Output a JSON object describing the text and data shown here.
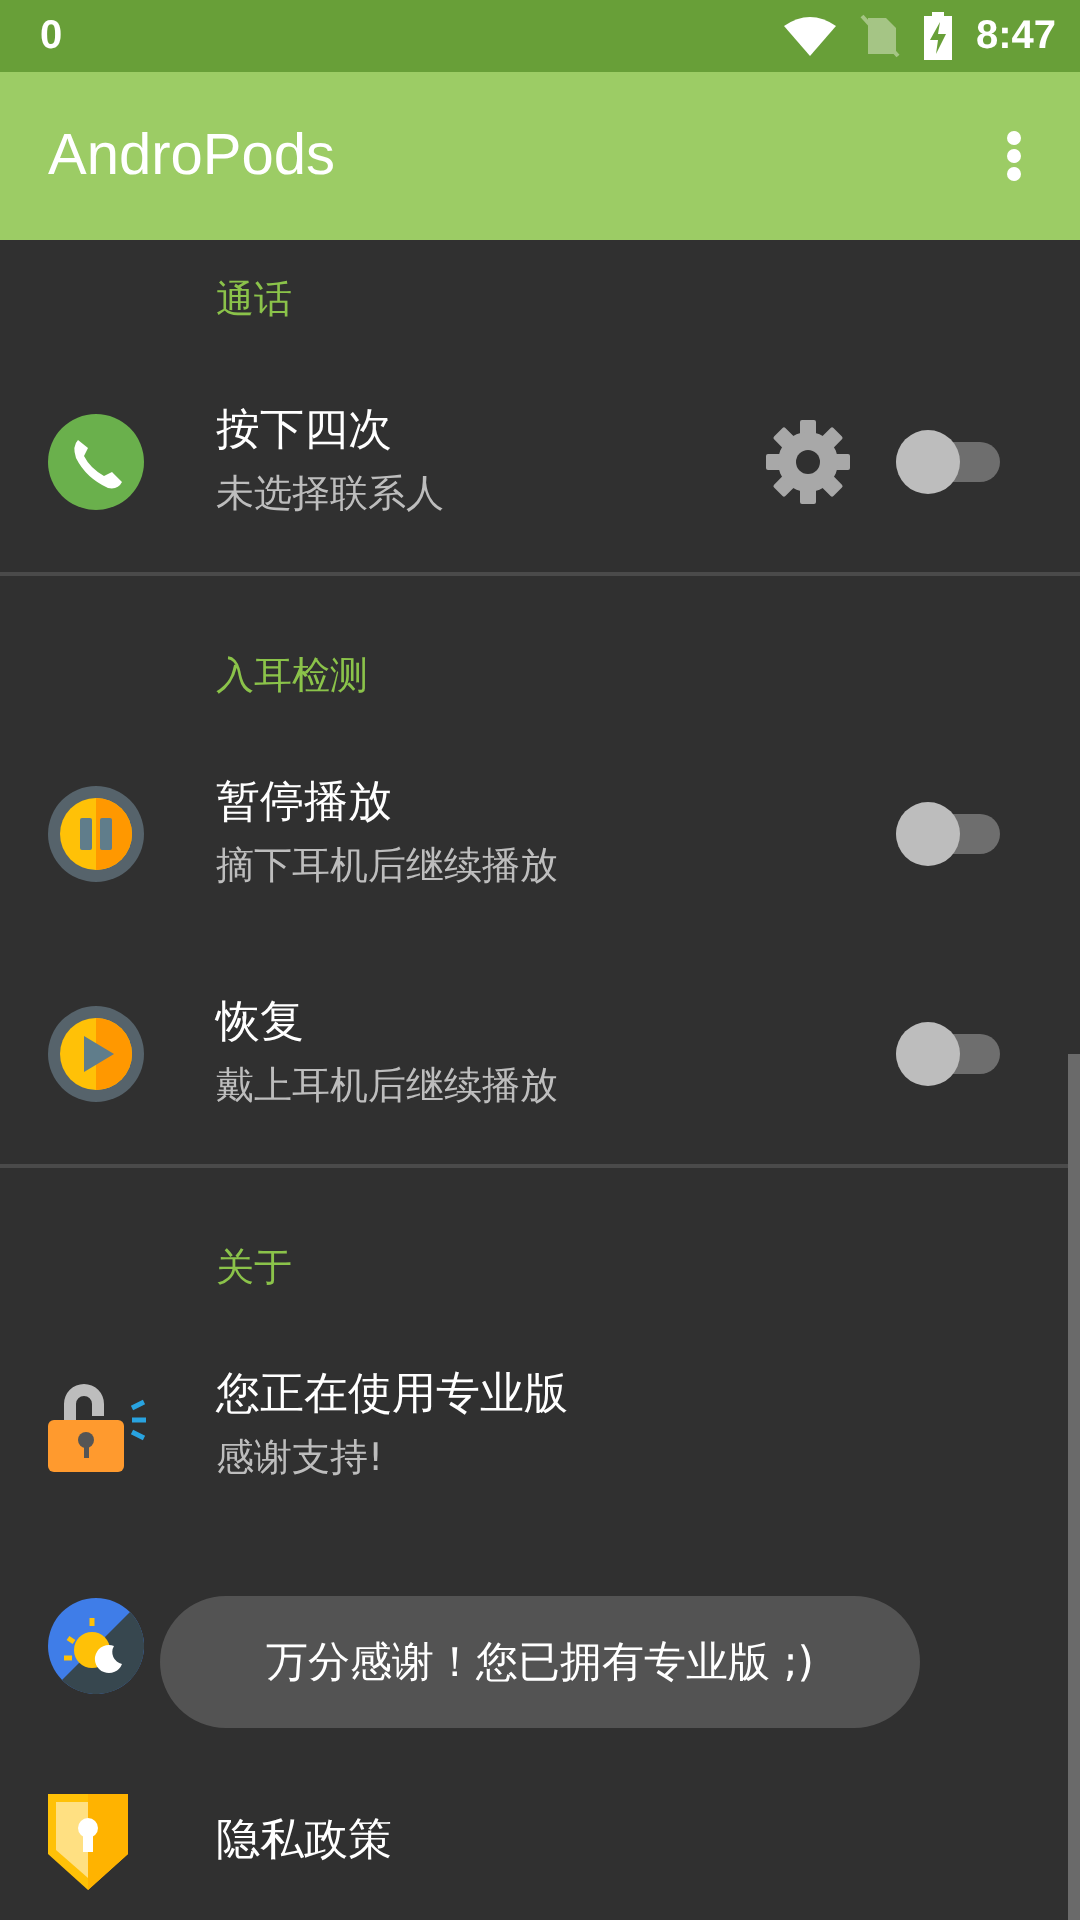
{
  "status_bar": {
    "notification": "0",
    "time": "8:47"
  },
  "app_bar": {
    "title": "AndroPods"
  },
  "sections": [
    {
      "header": "通话",
      "items": [
        {
          "kind": "phone",
          "title": "按下四次",
          "subtitle": "未选择联系人",
          "settings": true,
          "toggle": {
            "on": false
          }
        }
      ]
    },
    {
      "header": "入耳检测",
      "items": [
        {
          "kind": "pause",
          "title": "暂停播放",
          "subtitle": "摘下耳机后继续播放",
          "settings": false,
          "toggle": {
            "on": false
          }
        },
        {
          "kind": "play",
          "title": "恢复",
          "subtitle": "戴上耳机后继续播放",
          "settings": false,
          "toggle": {
            "on": false
          }
        }
      ]
    },
    {
      "header": "关于",
      "items": [
        {
          "kind": "lock",
          "title": "您正在使用专业版",
          "subtitle": "感谢支持!",
          "settings": false
        },
        {
          "kind": "daynight",
          "settings": false
        },
        {
          "kind": "shield",
          "title": "隐私政策",
          "settings": false
        }
      ]
    }
  ],
  "toast": {
    "text": "万分感谢！您已拥有专业版 ;)"
  }
}
